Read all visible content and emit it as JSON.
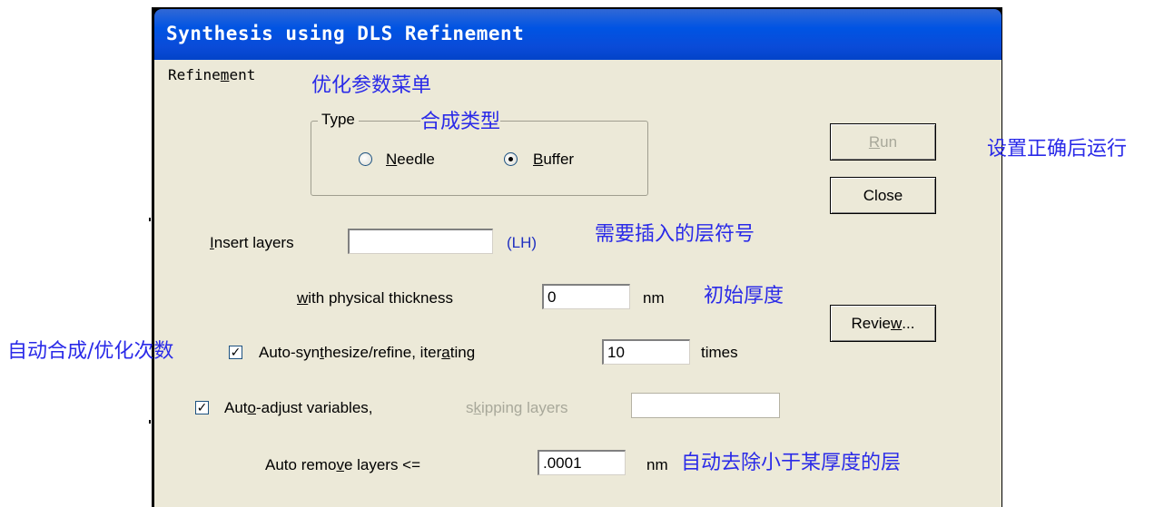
{
  "window": {
    "title": "Synthesis using DLS Refinement"
  },
  "menu": {
    "refinement": "Refinement"
  },
  "type_group": {
    "label": "Type",
    "needle": "Needle",
    "buffer": "Buffer",
    "selected": "Buffer"
  },
  "insert_layers": {
    "label": "Insert layers",
    "value": "",
    "suffix": "(LH)"
  },
  "thickness": {
    "label": "with physical thickness",
    "value": "0",
    "unit": "nm"
  },
  "auto_synth": {
    "checked": true,
    "label": "Auto-synthesize/refine, iterating",
    "value": "10",
    "unit": "times"
  },
  "auto_adjust": {
    "checked": true,
    "label": "Auto-adjust variables,",
    "skip_label": "skipping layers",
    "value": ""
  },
  "auto_remove": {
    "label": "Auto remove layers <=",
    "value": ".0001",
    "unit": "nm"
  },
  "buttons": {
    "run": "Run",
    "close": "Close",
    "review": "Review..."
  },
  "annotations": {
    "menu": "优化参数菜单",
    "type": "合成类型",
    "run": "设置正确后运行",
    "insert": "需要插入的层符号",
    "thickness": "初始厚度",
    "auto_synth": "自动合成/优化次数",
    "remove": "自动去除小于某厚度的层"
  }
}
